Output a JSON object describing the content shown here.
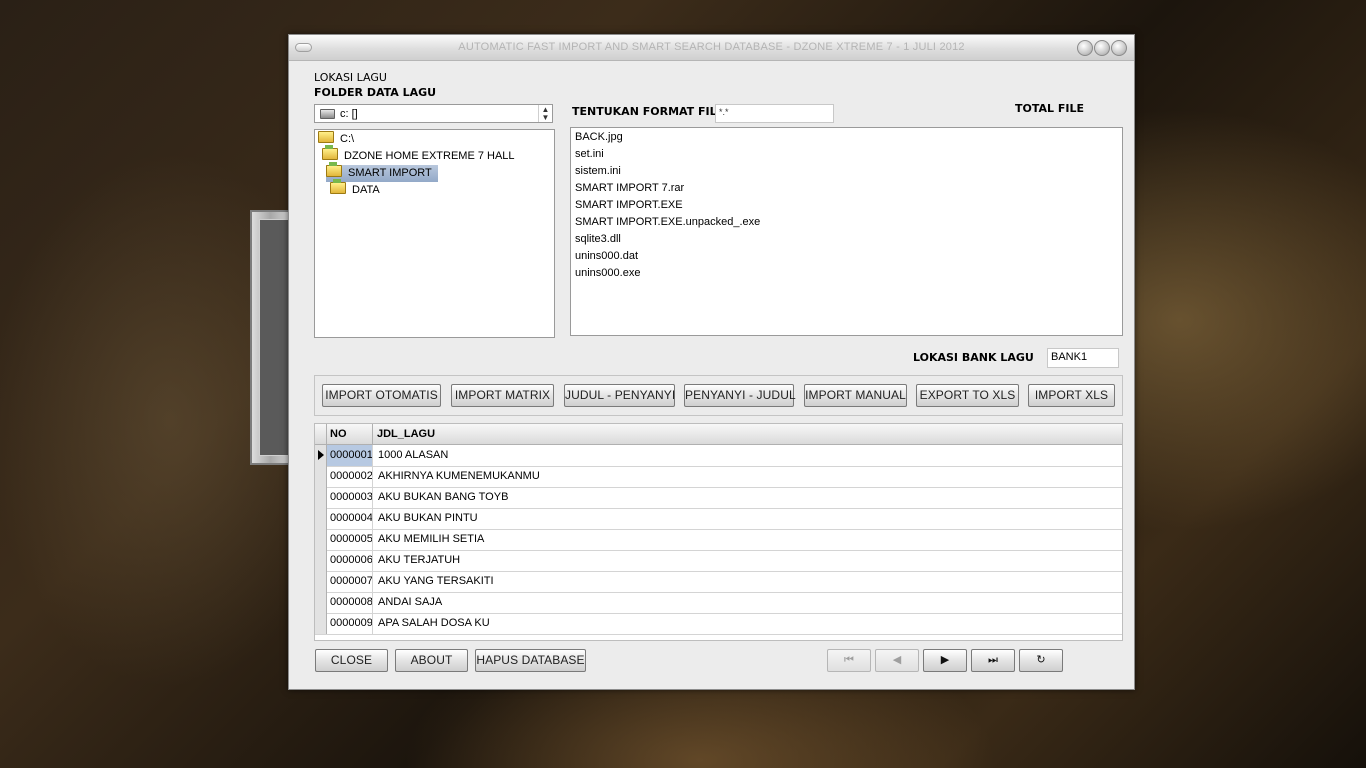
{
  "window": {
    "title": "AUTOMATIC FAST IMPORT AND SMART SEARCH DATABASE - DZONE XTREME 7 - 1 JULI 2012"
  },
  "labels": {
    "lokasi_lagu": "LOKASI LAGU",
    "folder_data_lagu": "FOLDER DATA LAGU",
    "tentukan_format_file": "TENTUKAN FORMAT FILE",
    "total_file": "TOTAL FILE",
    "lokasi_bank_lagu": "LOKASI BANK LAGU"
  },
  "drive": {
    "value": "c: []"
  },
  "format_file": {
    "value": "*.*"
  },
  "bank": {
    "value": "BANK1"
  },
  "tree": [
    {
      "label": "C:\\",
      "depth": 0,
      "selected": false
    },
    {
      "label": "DZONE HOME EXTREME 7 HALL",
      "depth": 1,
      "selected": false
    },
    {
      "label": "SMART IMPORT",
      "depth": 2,
      "selected": true
    },
    {
      "label": "DATA",
      "depth": 3,
      "selected": false
    }
  ],
  "files": [
    "BACK.jpg",
    "set.ini",
    "sistem.ini",
    "SMART IMPORT 7.rar",
    "SMART IMPORT.EXE",
    "SMART IMPORT.EXE.unpacked_.exe",
    "sqlite3.dll",
    "unins000.dat",
    "unins000.exe"
  ],
  "toolbar": {
    "import_otomatis": "IMPORT OTOMATIS",
    "import_matrix": "IMPORT MATRIX",
    "judul_penyanyi": "JUDUL - PENYANYI",
    "penyanyi_judul": "PENYANYI - JUDUL",
    "import_manual": "IMPORT MANUAL",
    "export_xls": "EXPORT TO XLS",
    "import_xls": "IMPORT XLS"
  },
  "grid": {
    "columns": {
      "no": "NO",
      "title": "JDL_LAGU"
    },
    "rows": [
      {
        "no": "0000001",
        "title": "1000 ALASAN"
      },
      {
        "no": "0000002",
        "title": "AKHIRNYA KUMENEMUKANMU"
      },
      {
        "no": "0000003",
        "title": "AKU BUKAN BANG TOYB"
      },
      {
        "no": "0000004",
        "title": "AKU BUKAN PINTU"
      },
      {
        "no": "0000005",
        "title": "AKU MEMILIH SETIA"
      },
      {
        "no": "0000006",
        "title": "AKU TERJATUH"
      },
      {
        "no": "0000007",
        "title": "AKU YANG TERSAKITI"
      },
      {
        "no": "0000008",
        "title": "ANDAI SAJA"
      },
      {
        "no": "0000009",
        "title": "APA SALAH DOSA KU"
      }
    ]
  },
  "footer": {
    "close": "CLOSE",
    "about": "ABOUT",
    "hapus_database": "HAPUS DATABASE"
  },
  "navigator": [
    {
      "icon": "first-record-icon",
      "glyph": "⏮",
      "enabled": false
    },
    {
      "icon": "prior-record-icon",
      "glyph": "◀",
      "enabled": false
    },
    {
      "icon": "next-record-icon",
      "glyph": "▶",
      "enabled": true
    },
    {
      "icon": "last-record-icon",
      "glyph": "⏭",
      "enabled": true
    },
    {
      "icon": "refresh-icon",
      "glyph": "↻",
      "enabled": true
    }
  ],
  "colors": {
    "selection": "#93a9c8",
    "window_bg": "#ececec"
  }
}
